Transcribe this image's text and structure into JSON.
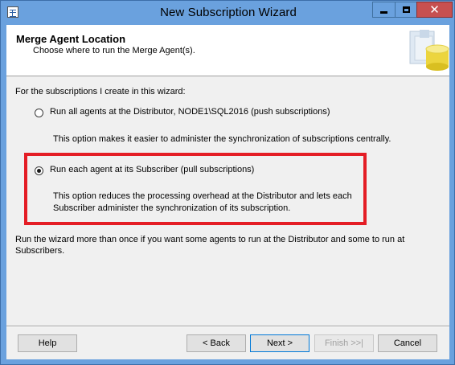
{
  "window": {
    "title": "New Subscription Wizard"
  },
  "header": {
    "title": "Merge Agent Location",
    "subtitle": "Choose where to run the Merge Agent(s)."
  },
  "body": {
    "intro": "For the subscriptions I create in this wizard:",
    "options": [
      {
        "label": "Run all agents at the Distributor, NODE1\\SQL2016 (push subscriptions)",
        "description": "This option makes it easier to administer the synchronization of subscriptions centrally.",
        "selected": false
      },
      {
        "label": "Run each agent at its Subscriber (pull subscriptions)",
        "description": "This option reduces the processing overhead at the Distributor and lets each Subscriber administer the synchronization of its subscription.",
        "selected": true
      }
    ],
    "note": "Run the wizard more than once if you want some agents to run at the Distributor and some to run at Subscribers."
  },
  "buttons": {
    "help": "Help",
    "back": "< Back",
    "next": "Next >",
    "finish": "Finish >>|",
    "cancel": "Cancel"
  },
  "colors": {
    "titlebar": "#6aa1de",
    "close": "#c75050",
    "highlight": "#e41d25"
  },
  "icons": {
    "app": "wizard-app-icon",
    "header_graphic": "database-cylinder-icon"
  }
}
